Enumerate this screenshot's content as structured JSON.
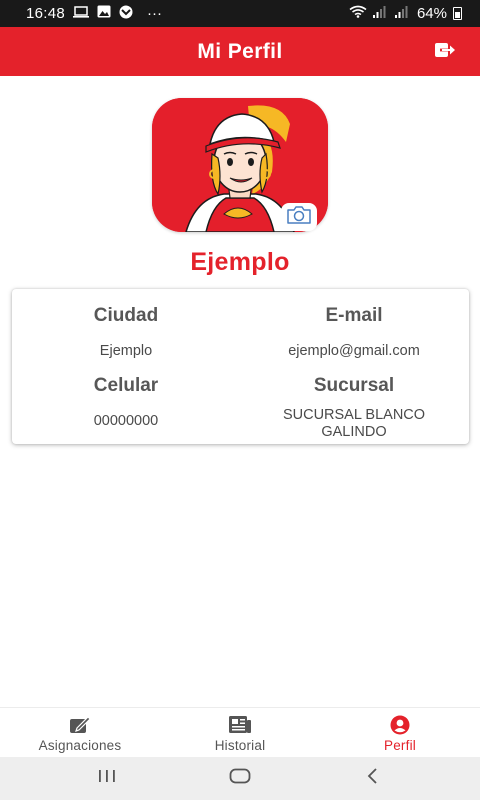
{
  "status_bar": {
    "time": "16:48",
    "notification_dots": "···",
    "battery_percent": "64%"
  },
  "app_bar": {
    "title": "Mi Perfil"
  },
  "profile": {
    "name": "Ejemplo"
  },
  "info": {
    "ciudad_label": "Ciudad",
    "ciudad_value": "Ejemplo",
    "email_label": "E-mail",
    "email_value": "ejemplo@gmail.com",
    "celular_label": "Celular",
    "celular_value": "00000000",
    "sucursal_label": "Sucursal",
    "sucursal_value_line1": "SUCURSAL BLANCO",
    "sucursal_value_line2": "GALINDO"
  },
  "bottom_nav": {
    "items": [
      {
        "label": "Asignaciones",
        "icon": "edit-note-icon",
        "active": false
      },
      {
        "label": "Historial",
        "icon": "newspaper-icon",
        "active": false
      },
      {
        "label": "Perfil",
        "icon": "account-circle-icon",
        "active": true
      }
    ]
  },
  "colors": {
    "brand_red": "#e4222b",
    "status_bar": "#191919",
    "system_nav": "#eeeeee"
  }
}
